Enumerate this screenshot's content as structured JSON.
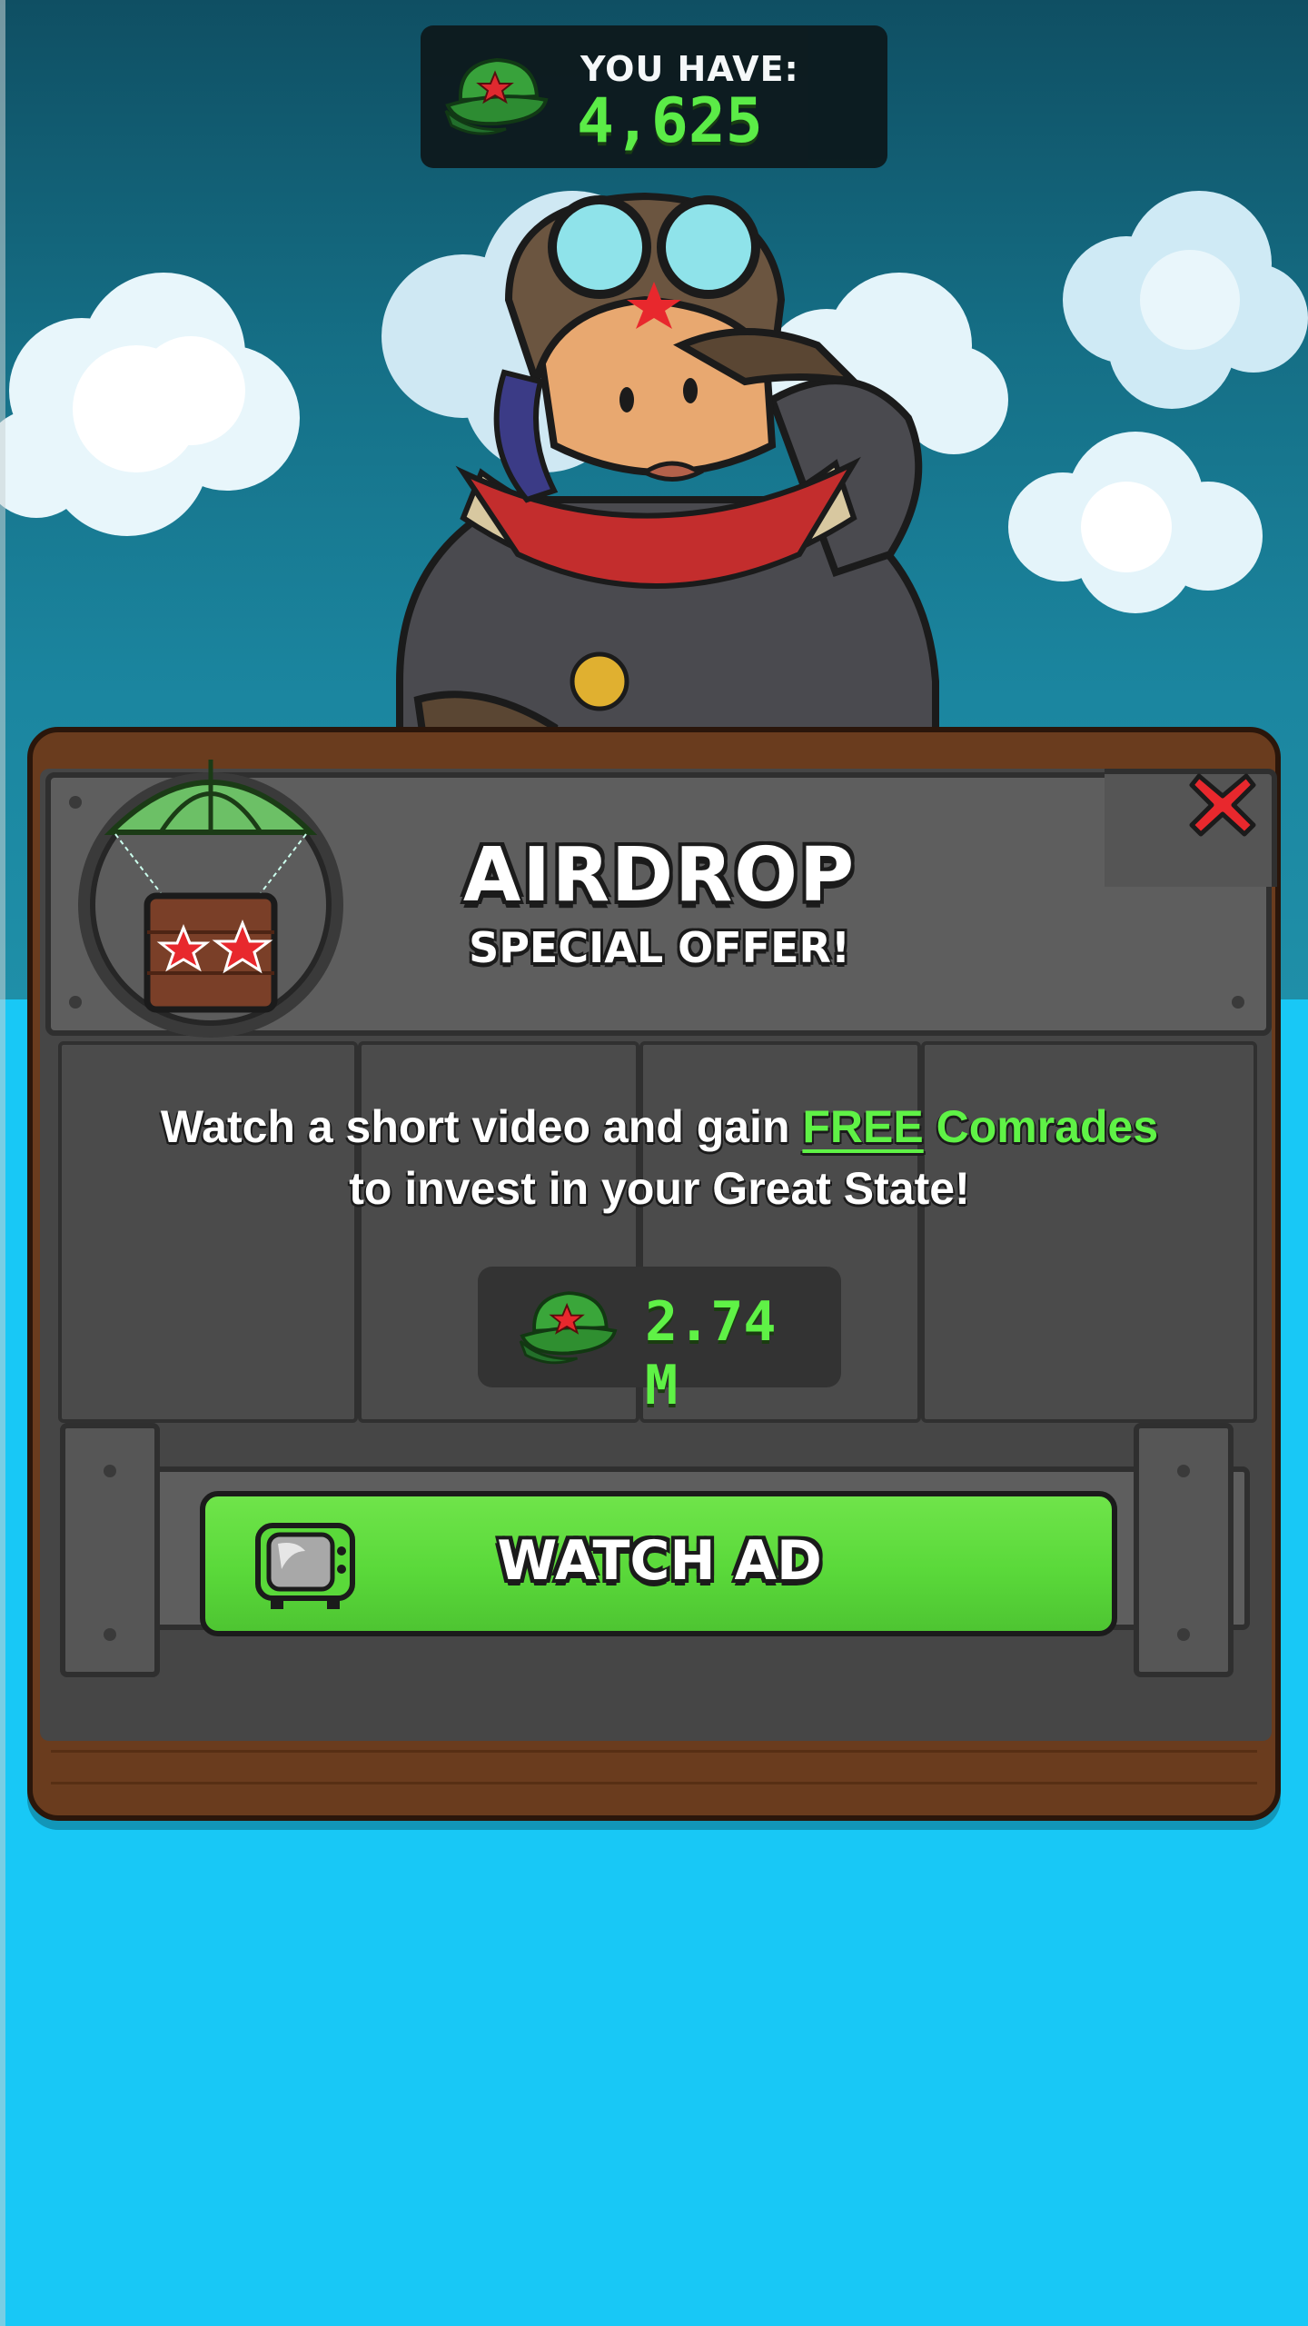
{
  "hud": {
    "label": "YOU HAVE:",
    "value": "4,625",
    "icon": "green-army-cap-icon"
  },
  "popup": {
    "title": "AIRDROP",
    "subtitle": "SPECIAL OFFER!",
    "description": {
      "part1": "Watch a short video and gain ",
      "free": "FREE",
      "comrades": " Comrades",
      "line2": "to invest in your Great State!"
    },
    "reward": {
      "value": "2.74 M",
      "icon": "green-army-cap-icon"
    },
    "button_label": "WATCH AD",
    "close_icon": "close-x-icon",
    "emblem_icon": "parachute-crate-icon"
  },
  "colors": {
    "accent_green": "#5ff246",
    "button_green": "#5ad93a",
    "close_red": "#e8282d",
    "sky_dark": "#0f4f63",
    "water_blue": "#18c8f6"
  }
}
